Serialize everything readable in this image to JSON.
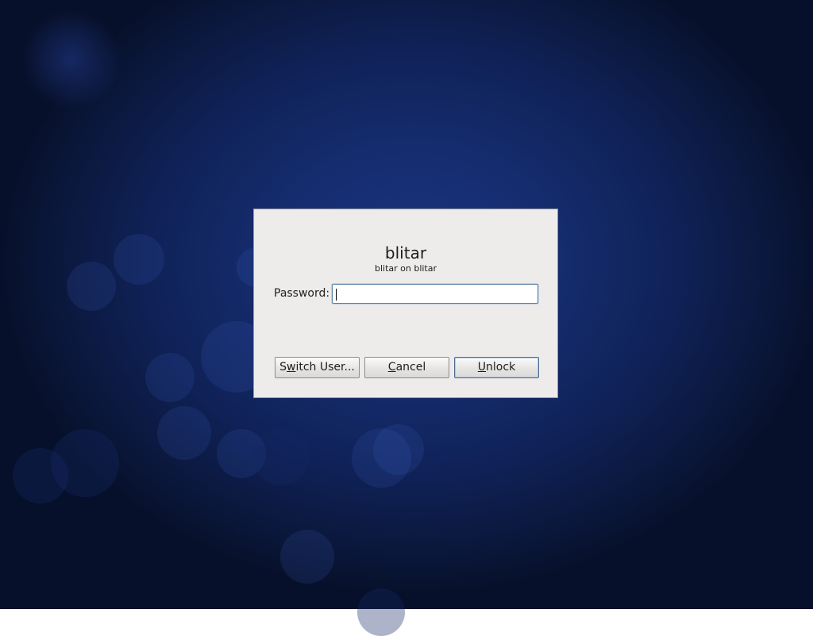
{
  "dialog": {
    "username": "blitar",
    "host_line": "blitar on blitar",
    "password_label": "Password:",
    "password_value": "",
    "buttons": {
      "switch_user": {
        "before": "S",
        "mnemonic": "w",
        "after": "itch User..."
      },
      "cancel": {
        "before": "",
        "mnemonic": "C",
        "after": "ancel"
      },
      "unlock": {
        "before": "",
        "mnemonic": "U",
        "after": "nlock"
      }
    }
  },
  "theme": {
    "background": "#152c6e",
    "dialog_background": "#edeceb",
    "focus_border": "#4d6f98"
  }
}
